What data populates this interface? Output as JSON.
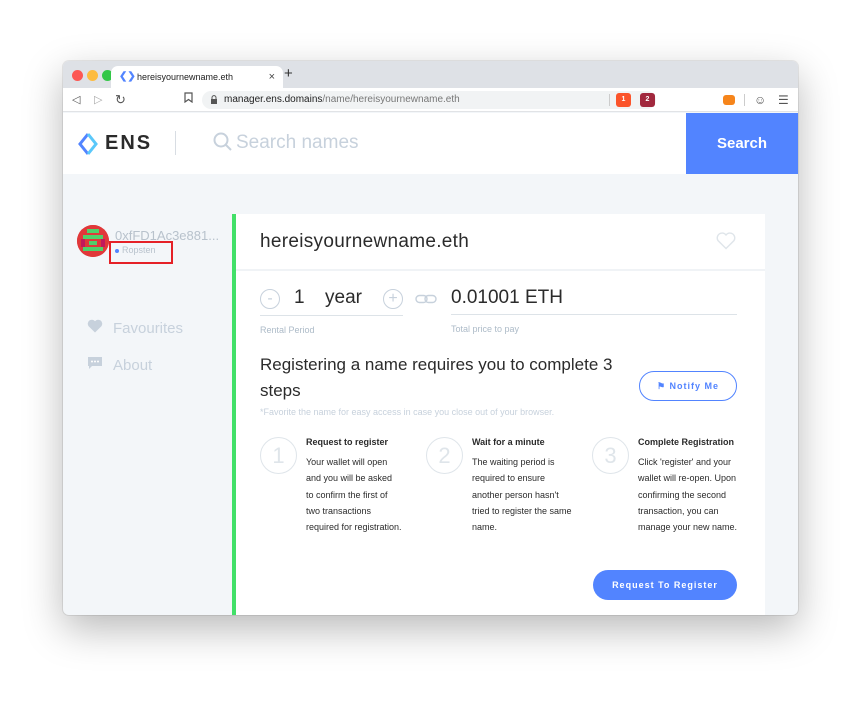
{
  "browser": {
    "tab_title": "hereisyournewname.eth",
    "tab_close": "×",
    "new_tab": "+",
    "url_host": "manager.ens.domains",
    "url_path": "/name/hereisyournewname.eth",
    "brave_shield_count": "1",
    "rewards_count": "2"
  },
  "header": {
    "logo_text": "ENS",
    "search_placeholder": "Search names",
    "search_button": "Search"
  },
  "sidebar": {
    "account": "0xfFD1Ac3e881...",
    "network": "Ropsten",
    "links": [
      {
        "label": "Favourites",
        "icon": "heart-icon"
      },
      {
        "label": "About",
        "icon": "chat-icon"
      }
    ]
  },
  "card": {
    "name": "hereisyournewname.eth",
    "decrease": "-",
    "increase": "+",
    "rental_value": "1",
    "rental_unit": "year",
    "rental_label": "Rental Period",
    "price": "0.01001 ETH",
    "price_label": "Total price to pay",
    "heading": "Registering a name requires you to complete 3 steps",
    "notify_button": "Notify Me",
    "note": "*Favorite the name for easy access in case you close out of your browser.",
    "steps": [
      {
        "num": "1",
        "title": "Request to register",
        "body": "Your wallet will open and you will be asked to confirm the first of two transactions required for registration."
      },
      {
        "num": "2",
        "title": "Wait for a minute",
        "body": "The waiting period is required to ensure another person hasn't tried to register the same name."
      },
      {
        "num": "3",
        "title": "Complete Registration",
        "body": "Click 'register' and your wallet will re-open. Upon confirming the second transaction, you can manage your new name."
      }
    ],
    "register_button": "Request To Register"
  },
  "colors": {
    "accent": "#5284ff",
    "card_accent": "#42e068",
    "highlight": "#e52127"
  }
}
